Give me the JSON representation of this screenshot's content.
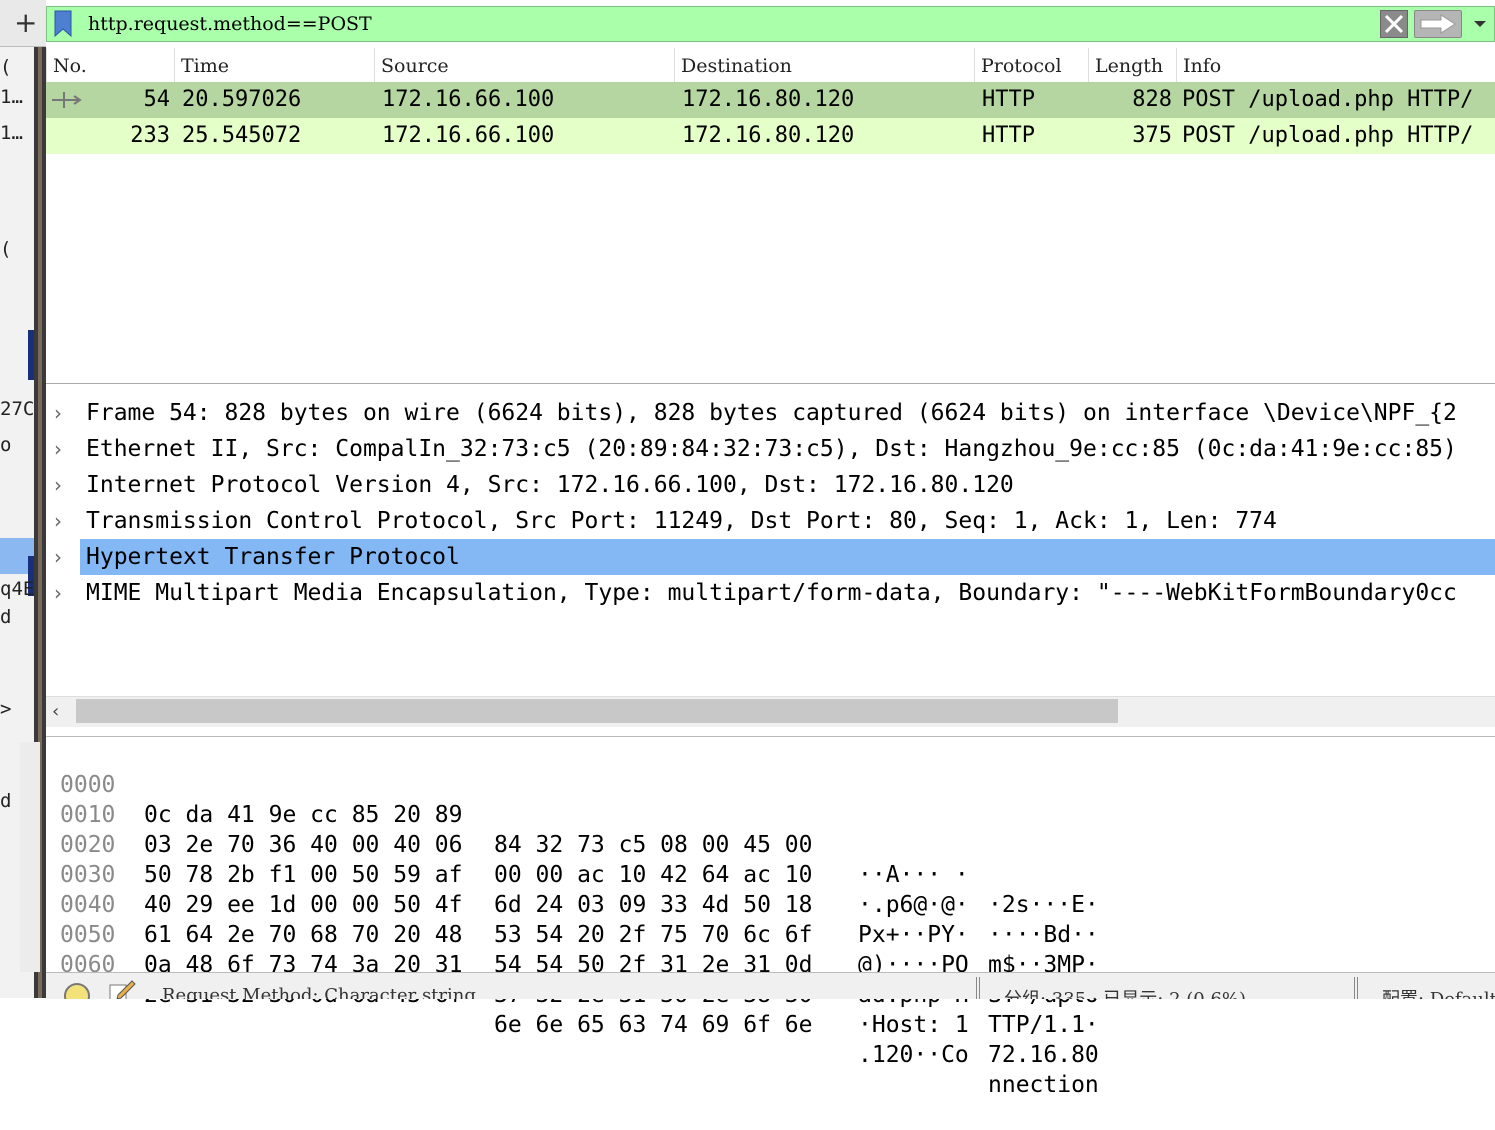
{
  "left_strip": {
    "fragments": [
      "(",
      "1…",
      "1…",
      "(",
      "27C",
      "o",
      "q4E",
      "d",
      ">",
      "d"
    ]
  },
  "filter": {
    "value": "http.request.method==POST"
  },
  "packet_list": {
    "columns": [
      "No.",
      "Time",
      "Source",
      "Destination",
      "Protocol",
      "Length",
      "Info"
    ],
    "rows": [
      {
        "no": "54",
        "time": "20.597026",
        "source": "172.16.66.100",
        "destination": "172.16.80.120",
        "protocol": "HTTP",
        "length": "828",
        "info": "POST /upload.php HTTP/"
      },
      {
        "no": "233",
        "time": "25.545072",
        "source": "172.16.66.100",
        "destination": "172.16.80.120",
        "protocol": "HTTP",
        "length": "375",
        "info": "POST /upload.php HTTP/"
      }
    ]
  },
  "details": {
    "items": [
      "Frame 54: 828 bytes on wire (6624 bits), 828 bytes captured (6624 bits) on interface \\Device\\NPF_{2",
      "Ethernet II, Src: CompalIn_32:73:c5 (20:89:84:32:73:c5), Dst: Hangzhou_9e:cc:85 (0c:da:41:9e:cc:85)",
      "Internet Protocol Version 4, Src: 172.16.66.100, Dst: 172.16.80.120",
      "Transmission Control Protocol, Src Port: 11249, Dst Port: 80, Seq: 1, Ack: 1, Len: 774",
      "Hypertext Transfer Protocol",
      "MIME Multipart Media Encapsulation, Type: multipart/form-data, Boundary: \"----WebKitFormBoundary0cc"
    ]
  },
  "bytes": {
    "rows": [
      {
        "offset": "0000",
        "hex1": "0c da 41 9e cc 85 20 89",
        "hex2": "84 32 73 c5 08 00 45 00",
        "ascii1": "··A··· ·",
        "ascii2": "·2s···E·"
      },
      {
        "offset": "0010",
        "hex1": "03 2e 70 36 40 00 40 06",
        "hex2": "00 00 ac 10 42 64 ac 10",
        "ascii1": "·.p6@·@·",
        "ascii2": "····Bd··"
      },
      {
        "offset": "0020",
        "hex1": "50 78 2b f1 00 50 59 af",
        "hex2": "6d 24 03 09 33 4d 50 18",
        "ascii1": "Px+··PY·",
        "ascii2": "m$··3MP·"
      },
      {
        "offset": "0030",
        "hex1": "40 29 ee 1d 00 00 50 4f",
        "hex2": "53 54 20 2f 75 70 6c 6f",
        "ascii1": "@)····PO",
        "ascii2": "ST /uplo"
      },
      {
        "offset": "0040",
        "hex1": "61 64 2e 70 68 70 20 48",
        "hex2": "54 54 50 2f 31 2e 31 0d",
        "ascii1": "ad.php H",
        "ascii2": "TTP/1.1·"
      },
      {
        "offset": "0050",
        "hex1": "0a 48 6f 73 74 3a 20 31",
        "hex2": "37 32 2e 31 36 2e 38 30",
        "ascii1": "·Host: 1",
        "ascii2": "72.16.80"
      },
      {
        "offset": "0060",
        "hex1": "2e 31 32 30 0d 0a 43 6f",
        "hex2": "6e 6e 65 63 74 69 6f 6e",
        "ascii1": ".120··Co",
        "ascii2": "nnection"
      }
    ]
  },
  "status": {
    "field_info": "Request Method: Character string",
    "packets": "分组: 335 · 已显示: 2 (0.6%)",
    "profile": "配置: Default"
  },
  "colors": {
    "filter_valid": "#aaffaa",
    "row_selected": "#b5d6a0",
    "row_http": "#e4ffc7",
    "tree_selected": "#84b8f5"
  },
  "icons": [
    "plus-icon",
    "bookmark-icon",
    "clear-icon",
    "apply-arrow-icon",
    "dropdown-icon",
    "related-packet-icon",
    "chevron-right-icon",
    "chevron-left-icon",
    "status-light-icon",
    "edit-icon"
  ]
}
